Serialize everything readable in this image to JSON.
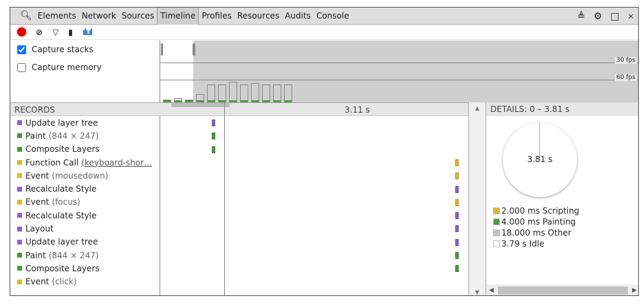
{
  "tabs": [
    "Elements",
    "Network",
    "Sources",
    "Timeline",
    "Profiles",
    "Resources",
    "Audits",
    "Console"
  ],
  "active_tab": "Timeline",
  "options": {
    "capture_stacks": "Capture stacks",
    "capture_memory": "Capture memory"
  },
  "overview": {
    "fps30": "30 fps",
    "fps60": "60 fps"
  },
  "records_header": "RECORDS",
  "time_label": "3.11 s",
  "records": [
    {
      "label": "Update layer tree",
      "detail": "",
      "link": "",
      "color": "#8a63d2"
    },
    {
      "label": "Paint",
      "detail": "(844 × 247)",
      "link": "",
      "color": "#4a9a3e"
    },
    {
      "label": "Composite Layers",
      "detail": "",
      "link": "",
      "color": "#4a9a3e"
    },
    {
      "label": "Function Call",
      "detail": "",
      "link": "(keyboard-shor…",
      "color": "#e3b42c"
    },
    {
      "label": "Event",
      "detail": "(mousedown)",
      "link": "",
      "color": "#e3b42c"
    },
    {
      "label": "Recalculate Style",
      "detail": "",
      "link": "",
      "color": "#8a63d2"
    },
    {
      "label": "Event",
      "detail": "(focus)",
      "link": "",
      "color": "#e3b42c"
    },
    {
      "label": "Recalculate Style",
      "detail": "",
      "link": "",
      "color": "#8a63d2"
    },
    {
      "label": "Layout",
      "detail": "",
      "link": "",
      "color": "#8a63d2"
    },
    {
      "label": "Update layer tree",
      "detail": "",
      "link": "",
      "color": "#8a63d2"
    },
    {
      "label": "Paint",
      "detail": "(844 × 247)",
      "link": "",
      "color": "#4a9a3e"
    },
    {
      "label": "Composite Layers",
      "detail": "",
      "link": "",
      "color": "#4a9a3e"
    },
    {
      "label": "Event",
      "detail": "(click)",
      "link": "",
      "color": "#e3b42c"
    }
  ],
  "details": {
    "header": "DETAILS: 0 – 3.81 s",
    "total": "3.81 s",
    "legend": [
      {
        "label": "2.000 ms Scripting",
        "color": "#e3b42c"
      },
      {
        "label": "4.000 ms Painting",
        "color": "#4a9a3e"
      },
      {
        "label": "18.000 ms Other",
        "color": "#c2c2c2"
      },
      {
        "label": "3.79 s Idle",
        "color": "#ffffff"
      }
    ]
  }
}
